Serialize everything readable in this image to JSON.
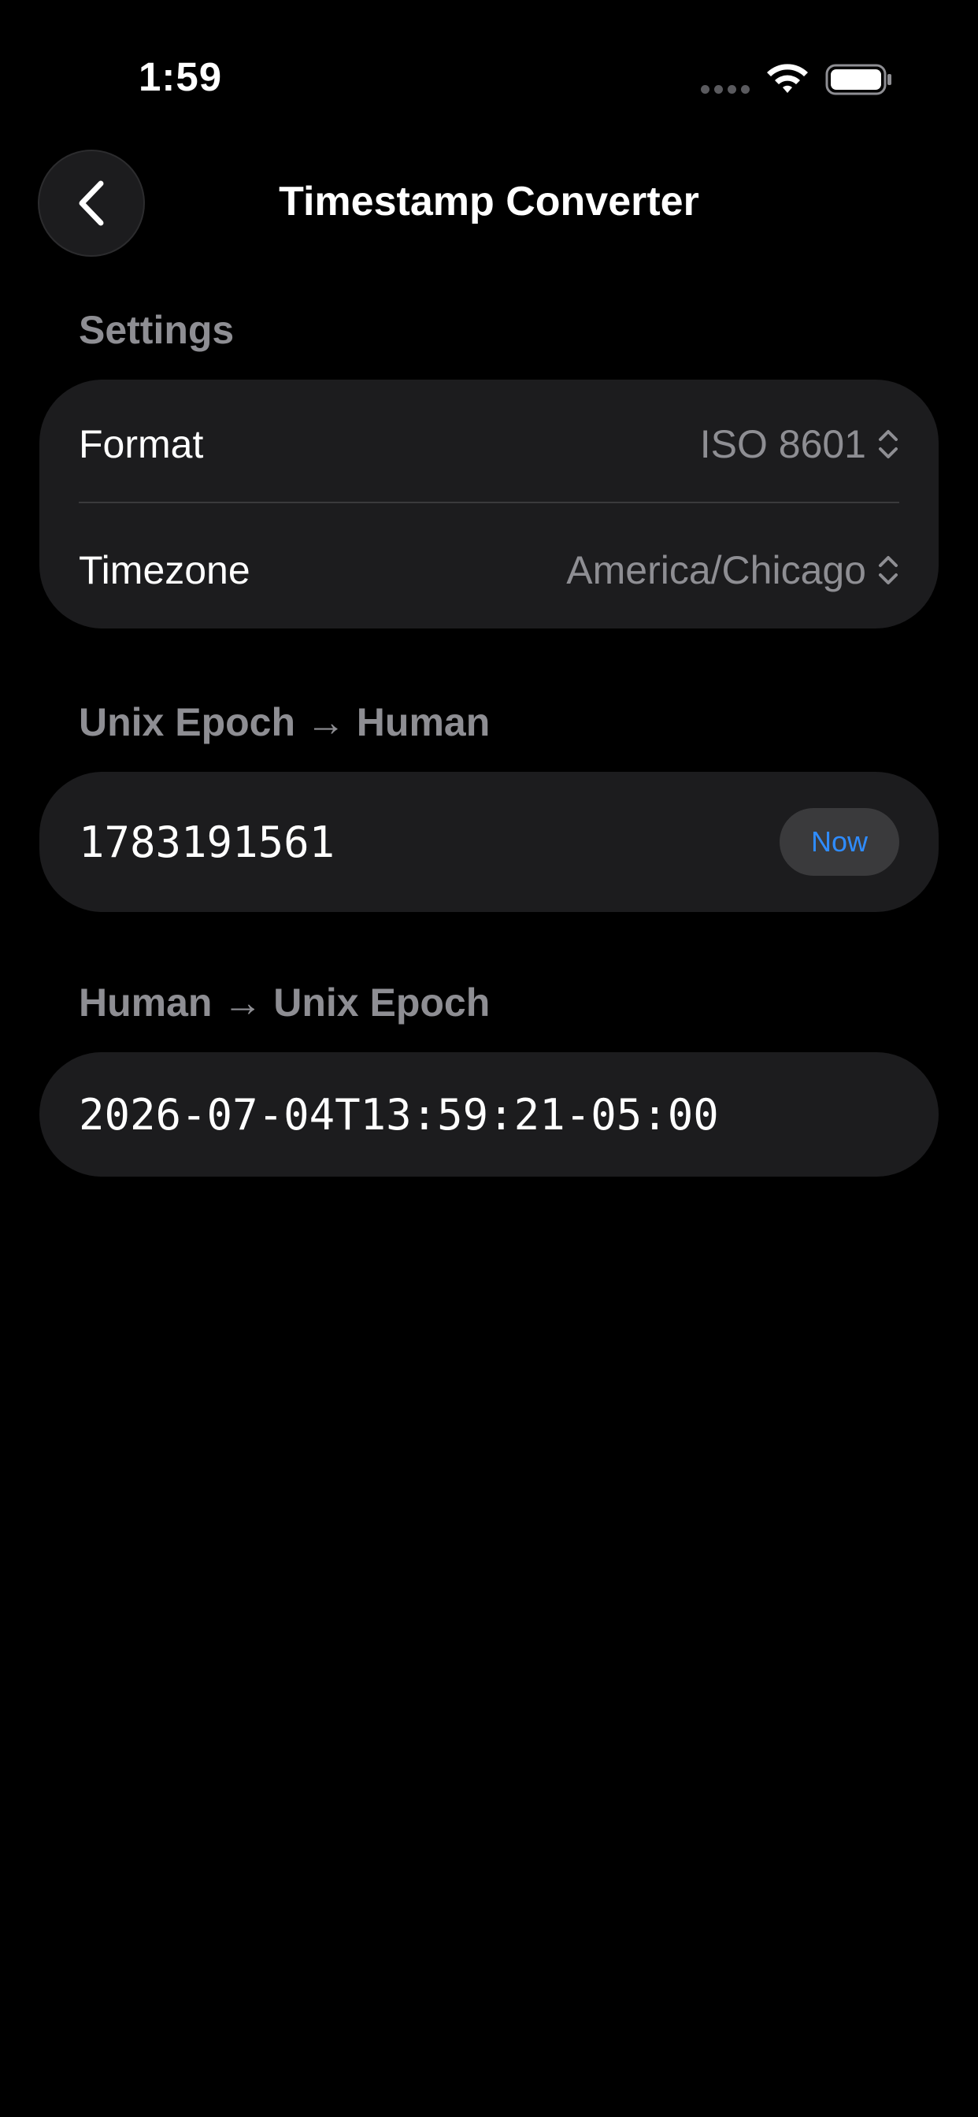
{
  "status_bar": {
    "time": "1:59"
  },
  "nav": {
    "title": "Timestamp Converter",
    "back_icon": "chevron-left-icon"
  },
  "settings": {
    "header": "Settings",
    "format_label": "Format",
    "format_value": "ISO 8601",
    "timezone_label": "Timezone",
    "timezone_value": "America/Chicago",
    "picker_icon": "chevron-up-down-icon"
  },
  "epoch_to_human": {
    "header": "Unix Epoch → Human",
    "input_value": "1783191561",
    "now_label": "Now"
  },
  "human_to_epoch": {
    "header": "Human → Unix Epoch",
    "input_value": "2026-07-04T13:59:21-05:00"
  },
  "colors": {
    "background": "#000000",
    "card": "#1c1c1e",
    "secondary_text": "#8e8e93",
    "accent": "#2f8cff"
  }
}
